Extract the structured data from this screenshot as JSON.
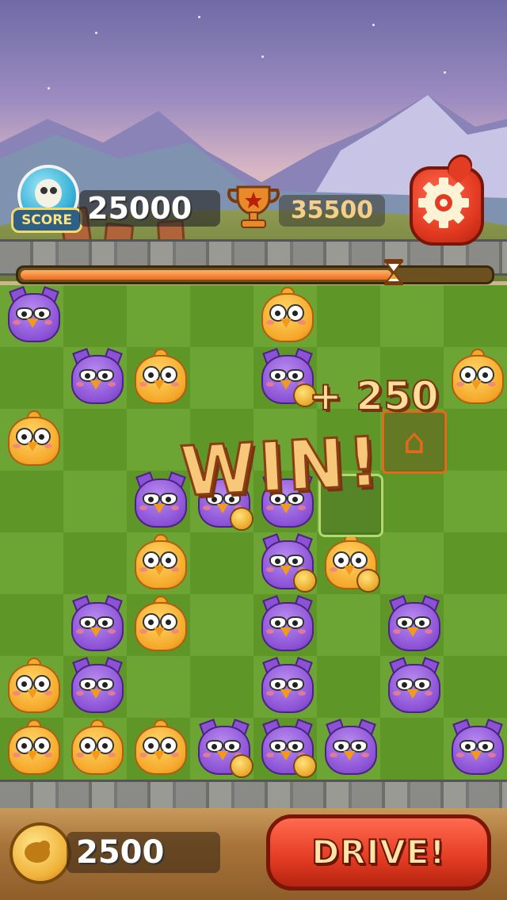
{
  "hud": {
    "score_label": "SCORE",
    "score_value": "25000",
    "best_score": "35500",
    "timer_fraction": 0.79
  },
  "board": {
    "rows": 8,
    "cols": 8,
    "birds": [
      {
        "r": 0,
        "c": 0,
        "t": "purple"
      },
      {
        "r": 0,
        "c": 4,
        "t": "yellow"
      },
      {
        "r": 1,
        "c": 1,
        "t": "purple"
      },
      {
        "r": 1,
        "c": 2,
        "t": "yellow"
      },
      {
        "r": 1,
        "c": 4,
        "t": "purple",
        "coin": true
      },
      {
        "r": 1,
        "c": 7,
        "t": "yellow"
      },
      {
        "r": 2,
        "c": 0,
        "t": "yellow"
      },
      {
        "r": 3,
        "c": 2,
        "t": "purple"
      },
      {
        "r": 3,
        "c": 3,
        "t": "purple",
        "coin": true
      },
      {
        "r": 3,
        "c": 4,
        "t": "purple"
      },
      {
        "r": 4,
        "c": 2,
        "t": "yellow"
      },
      {
        "r": 4,
        "c": 4,
        "t": "purple",
        "coin": true
      },
      {
        "r": 4,
        "c": 5,
        "t": "yellow",
        "coin": true
      },
      {
        "r": 5,
        "c": 1,
        "t": "purple"
      },
      {
        "r": 5,
        "c": 2,
        "t": "yellow"
      },
      {
        "r": 5,
        "c": 4,
        "t": "purple"
      },
      {
        "r": 5,
        "c": 6,
        "t": "purple"
      },
      {
        "r": 6,
        "c": 0,
        "t": "yellow"
      },
      {
        "r": 6,
        "c": 1,
        "t": "purple"
      },
      {
        "r": 6,
        "c": 4,
        "t": "purple"
      },
      {
        "r": 6,
        "c": 6,
        "t": "purple"
      },
      {
        "r": 7,
        "c": 0,
        "t": "yellow"
      },
      {
        "r": 7,
        "c": 1,
        "t": "yellow"
      },
      {
        "r": 7,
        "c": 2,
        "t": "yellow"
      },
      {
        "r": 7,
        "c": 3,
        "t": "purple",
        "coin": true
      },
      {
        "r": 7,
        "c": 4,
        "t": "purple",
        "coin": true
      },
      {
        "r": 7,
        "c": 5,
        "t": "purple"
      },
      {
        "r": 7,
        "c": 7,
        "t": "purple"
      }
    ]
  },
  "popups": {
    "win_text": "WIN!",
    "bonus_text": "+ 250"
  },
  "footer": {
    "coins": "2500",
    "drive_label": "DRIVE!"
  },
  "colors": {
    "accent_red": "#e33b22",
    "timer_orange": "#f06a1c",
    "grass_light": "#6da534",
    "grass_dark": "#5e9628"
  }
}
